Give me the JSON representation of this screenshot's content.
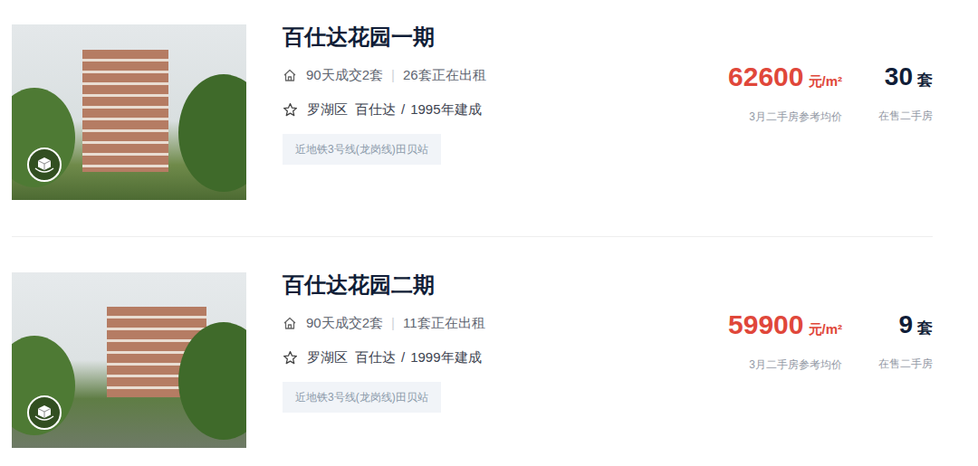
{
  "stat_separator": "|",
  "meta_separator": "/",
  "listings": [
    {
      "title": "百仕达花园一期",
      "deals": "90天成交2套",
      "rentals": "26套正在出租",
      "district": "罗湖区",
      "area": "百仕达",
      "built": "1995年建成",
      "tag": "近地铁3号线(龙岗线)田贝站",
      "price": "62600",
      "price_unit": "元/m²",
      "price_label": "3月二手房参考均价",
      "on_sale": "30",
      "on_sale_unit": "套",
      "on_sale_label": "在售二手房"
    },
    {
      "title": "百仕达花园二期",
      "deals": "90天成交2套",
      "rentals": "11套正在出租",
      "district": "罗湖区",
      "area": "百仕达",
      "built": "1999年建成",
      "tag": "近地铁3号线(龙岗线)田贝站",
      "price": "59900",
      "price_unit": "元/m²",
      "price_label": "3月二手房参考均价",
      "on_sale": "9",
      "on_sale_unit": "套",
      "on_sale_label": "在售二手房"
    }
  ]
}
